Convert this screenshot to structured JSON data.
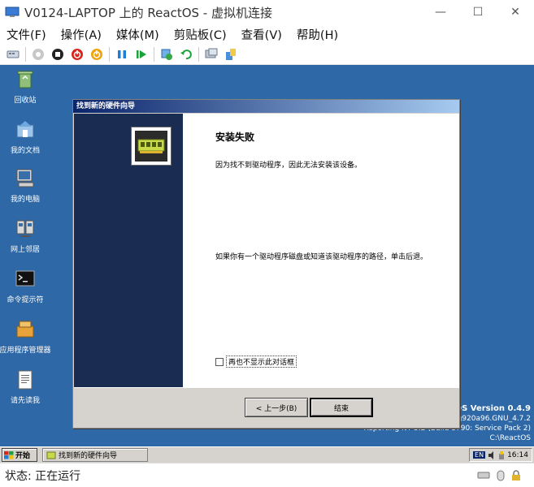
{
  "window": {
    "title": "V0124-LAPTOP 上的 ReactOS - 虚拟机连接",
    "minimize": "—",
    "maximize": "☐",
    "close": "✕"
  },
  "menu": [
    "文件(F)",
    "操作(A)",
    "媒体(M)",
    "剪贴板(C)",
    "查看(V)",
    "帮助(H)"
  ],
  "desktop_icons": [
    {
      "label": "回收站"
    },
    {
      "label": "我的文档"
    },
    {
      "label": "我的电脑"
    },
    {
      "label": "网上邻居"
    },
    {
      "label": "命令提示符"
    },
    {
      "label": "应用程序管理器"
    },
    {
      "label": "请先读我"
    }
  ],
  "wizard": {
    "caption": "找到新的硬件向导",
    "heading": "安装失败",
    "message1": "因为找不到驱动程序，因此无法安装该设备。",
    "message2": "如果你有一个驱动程序磁盘或知道该驱动程序的路径，单击后退。",
    "checkbox_label": "再也不显示此对话框",
    "back_button": "< 上一步(B)",
    "finish_button": "结束"
  },
  "os_version": {
    "line1": "ReactOS Version 0.4.9",
    "line2": "g920a96.GNU_4.7.2",
    "line3": "Reporting NT 5.2 (Build 3790: Service Pack 2)",
    "line4": "C:\\ReactOS"
  },
  "taskbar": {
    "start": "开始",
    "task": "找到新的硬件向导",
    "lang": "EN",
    "clock": "16:14"
  },
  "status": {
    "text": "状态: 正在运行"
  }
}
